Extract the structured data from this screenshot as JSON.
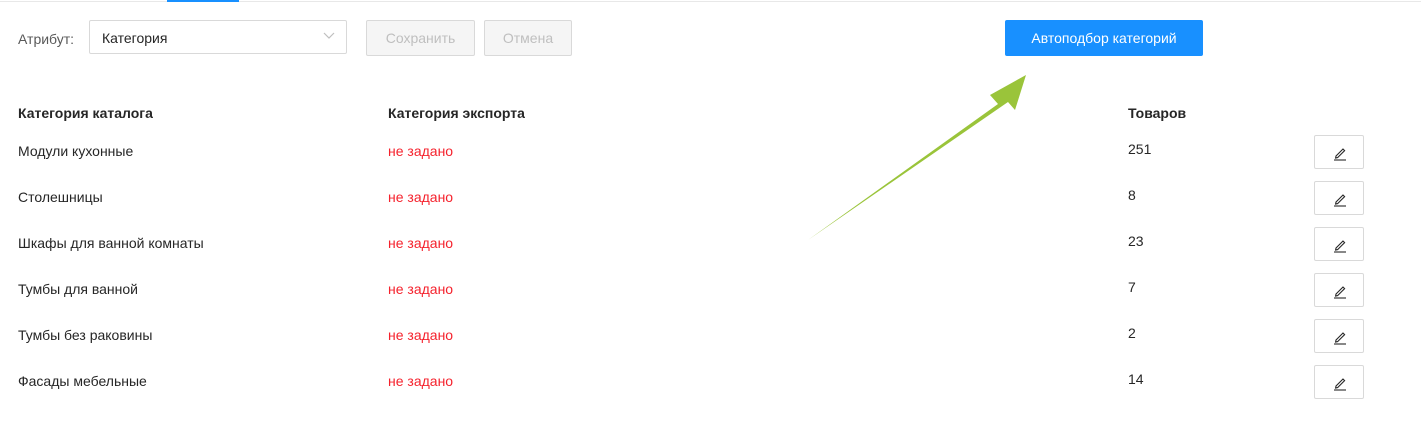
{
  "toolbar": {
    "attribute_label": "Атрибут:",
    "attribute_value": "Категория",
    "save_label": "Сохранить",
    "cancel_label": "Отмена",
    "auto_label": "Автоподбор категорий"
  },
  "table": {
    "headers": {
      "catalog": "Категория каталога",
      "export": "Категория экспорта",
      "count": "Товаров"
    },
    "rows": [
      {
        "category": "Модули кухонные",
        "export": "не задано",
        "count": "251"
      },
      {
        "category": "Столешницы",
        "export": "не задано",
        "count": "8"
      },
      {
        "category": "Шкафы для ванной комнаты",
        "export": "не задано",
        "count": "23"
      },
      {
        "category": "Тумбы для ванной",
        "export": "не задано",
        "count": "7"
      },
      {
        "category": "Тумбы без раковины",
        "export": "не задано",
        "count": "2"
      },
      {
        "category": "Фасады мебельные",
        "export": "не задано",
        "count": "14"
      }
    ]
  },
  "colors": {
    "primary": "#1890ff",
    "unset_text": "#f5222d",
    "annotation_arrow": "#9ac43a"
  },
  "icons": {
    "select_chevron": "chevron-down-icon",
    "row_edit": "pencil-icon"
  }
}
